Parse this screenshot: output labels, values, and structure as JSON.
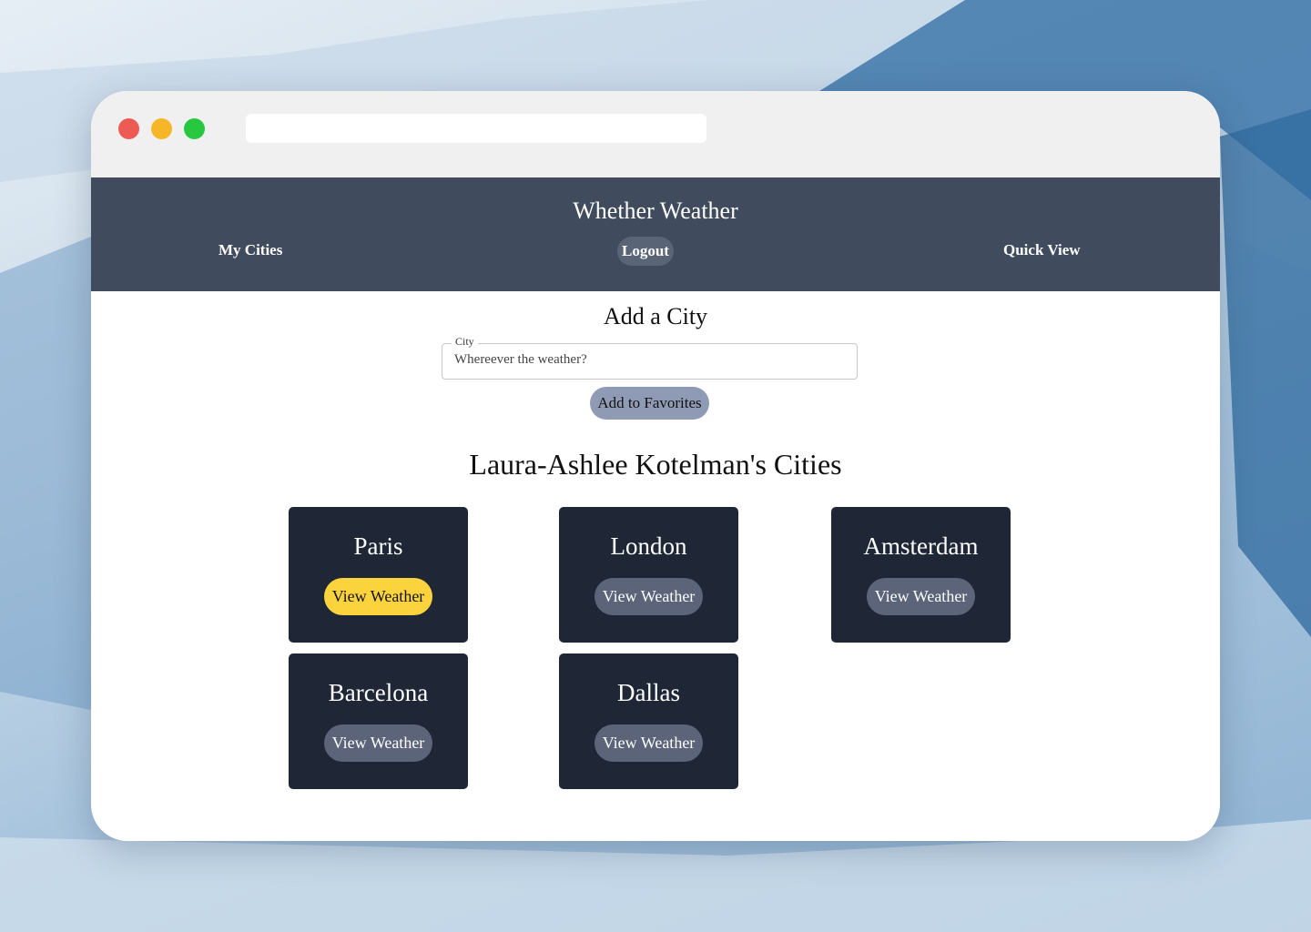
{
  "app": {
    "title": "Whether Weather"
  },
  "nav": {
    "my_cities": "My Cities",
    "logout": "Logout",
    "quick_view": "Quick View"
  },
  "add_city": {
    "heading": "Add a City",
    "field_label": "City",
    "placeholder": "Whereever the weather?",
    "value": "",
    "submit_label": "Add to Favorites"
  },
  "cities_heading": "Laura-Ashlee Kotelman's Cities",
  "cities": [
    {
      "name": "Paris",
      "button": "View Weather",
      "active": true
    },
    {
      "name": "London",
      "button": "View Weather",
      "active": false
    },
    {
      "name": "Amsterdam",
      "button": "View Weather",
      "active": false
    },
    {
      "name": "Barcelona",
      "button": "View Weather",
      "active": false
    },
    {
      "name": "Dallas",
      "button": "View Weather",
      "active": false
    }
  ],
  "colors": {
    "navbar": "#404b5e",
    "card": "#1f2737",
    "button": "#5b6479",
    "active_button": "#fbd33d",
    "add_button": "#8f9bb4"
  }
}
